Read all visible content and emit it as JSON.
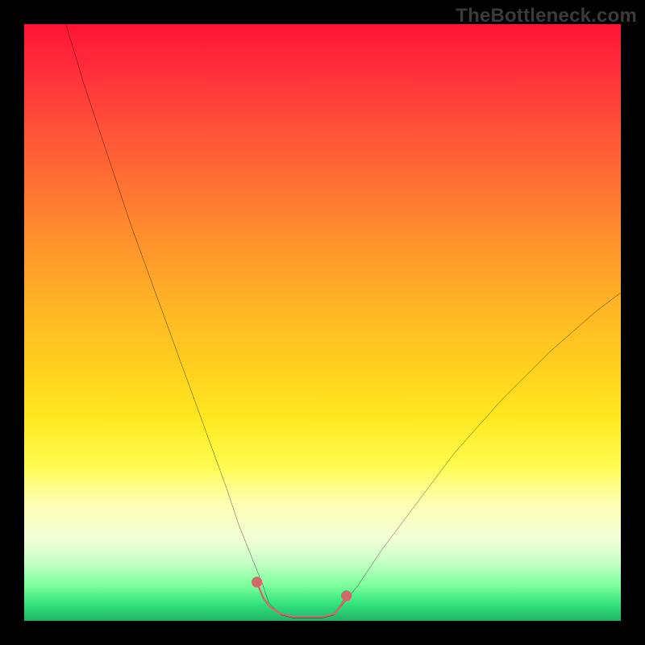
{
  "watermark": "TheBottleneck.com",
  "chart_data": {
    "type": "line",
    "title": "",
    "xlabel": "",
    "ylabel": "",
    "xlim": [
      0,
      100
    ],
    "ylim": [
      0,
      100
    ],
    "grid": false,
    "legend": false,
    "series": [
      {
        "name": "main-curve",
        "color": "#000000",
        "x": [
          7,
          10,
          14,
          18,
          22,
          26,
          30,
          34,
          36,
          38,
          40,
          41,
          43,
          45,
          48,
          50,
          52,
          56,
          60,
          66,
          72,
          80,
          88,
          96,
          100
        ],
        "y": [
          100,
          90,
          78,
          66,
          55,
          44,
          33,
          22,
          16,
          11,
          6,
          3,
          1,
          0.5,
          0.5,
          0.5,
          1,
          6,
          12,
          20,
          28,
          37,
          45,
          52,
          55
        ]
      },
      {
        "name": "highlight-segment",
        "color": "#d06a6a",
        "x": [
          39,
          40,
          41,
          43,
          45,
          48,
          50,
          52,
          53,
          54
        ],
        "y": [
          6.5,
          4,
          2.5,
          1.2,
          0.7,
          0.7,
          0.7,
          1.2,
          2.5,
          4.2
        ]
      }
    ],
    "gradient_stops": [
      {
        "pos": 0.0,
        "color": "#ff1436"
      },
      {
        "pos": 0.2,
        "color": "#ff5a38"
      },
      {
        "pos": 0.46,
        "color": "#ffb126"
      },
      {
        "pos": 0.66,
        "color": "#ffe820"
      },
      {
        "pos": 0.8,
        "color": "#ffffb0"
      },
      {
        "pos": 0.9,
        "color": "#c8ffc8"
      },
      {
        "pos": 1.0,
        "color": "#1fb465"
      }
    ]
  }
}
